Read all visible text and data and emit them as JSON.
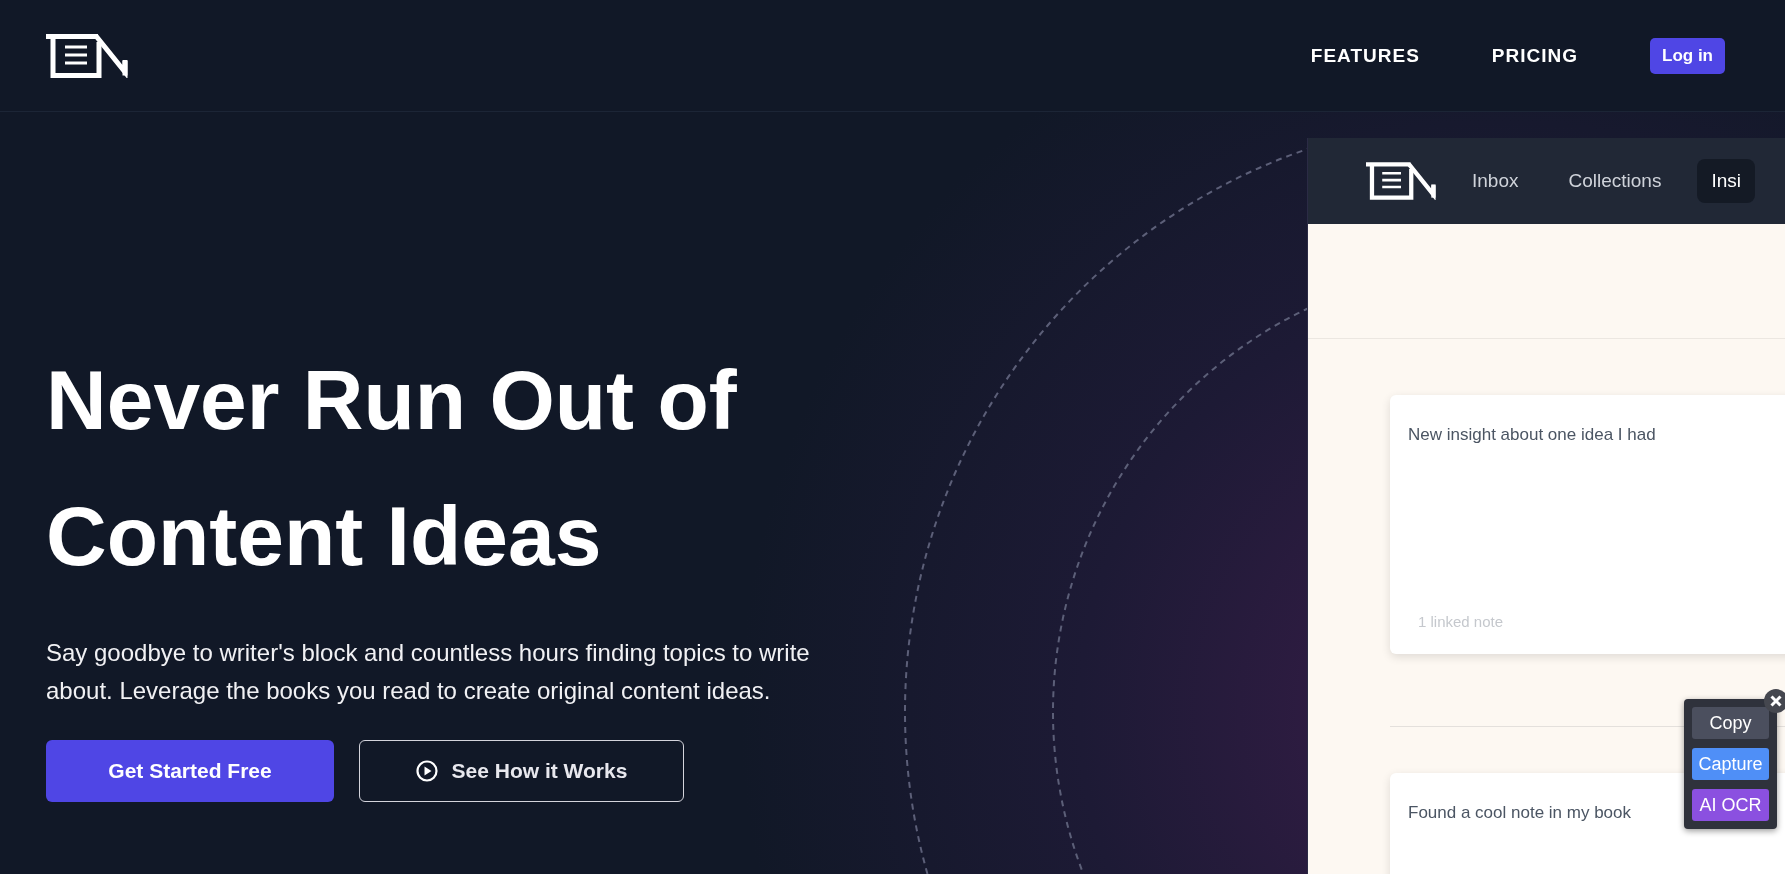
{
  "header": {
    "nav": [
      {
        "label": "FEATURES"
      },
      {
        "label": "PRICING"
      }
    ],
    "login_button": "Log in"
  },
  "hero": {
    "title": "Never Run Out of Content Ideas",
    "description": "Say goodbye to writer's block and countless hours finding topics to write about. Leverage the books you read to create original content ideas.",
    "buttons": [
      {
        "label": "Get Started Free",
        "kind": "primary"
      },
      {
        "label": "See How it Works",
        "kind": "outline"
      }
    ]
  },
  "app_preview": {
    "tabs": [
      {
        "label": "Inbox",
        "selected": false
      },
      {
        "label": "Collections",
        "selected": false
      },
      {
        "label": "Insi",
        "selected": true
      }
    ],
    "cards": [
      {
        "text": "New insight about one idea I had",
        "footer": "1 linked note"
      },
      {
        "text": "Found a cool note in my book"
      }
    ]
  },
  "popup": {
    "buttons": [
      {
        "label": "Copy",
        "kind": "copy"
      },
      {
        "label": "Capture",
        "kind": "capture"
      },
      {
        "label": "AI OCR",
        "kind": "ocr"
      }
    ]
  }
}
